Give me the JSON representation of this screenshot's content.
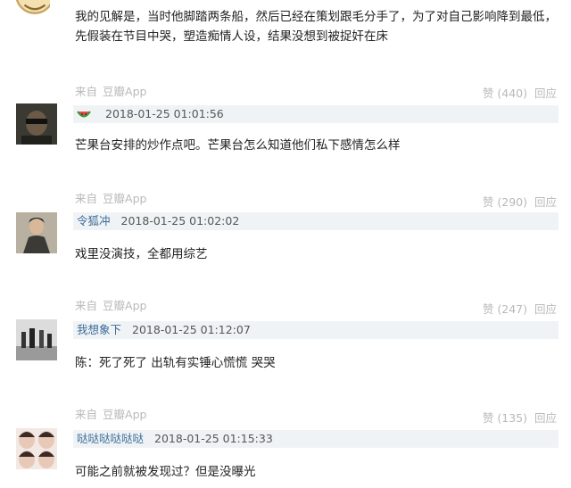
{
  "comments": [
    {
      "id": "c0",
      "text_lines": [
        "我的见解是，当时他脚踏两条船，然后已经在策划跟毛分手了，为了对自己影响降到最低，",
        "先假装在节目中哭，塑造痴情人设，结果没想到被捉奸在床"
      ],
      "source": {
        "prefix": "来自",
        "app": "豆瓣App"
      },
      "likes": "赞 (440)",
      "reply": "回应"
    },
    {
      "id": "c1",
      "user": "",
      "user_icon": "watermelon-icon",
      "time": "2018-01-25 01:01:56",
      "text": "芒果台安排的炒作点吧。芒果台怎么知道他们私下感情怎么样",
      "source": {
        "prefix": "来自",
        "app": "豆瓣App"
      },
      "likes": "赞 (290)",
      "reply": "回应"
    },
    {
      "id": "c2",
      "user": "令狐冲",
      "time": "2018-01-25 01:02:02",
      "text": "戏里没演技，全都用综艺",
      "source": {
        "prefix": "来自",
        "app": "豆瓣App"
      },
      "likes": "赞 (247)",
      "reply": "回应"
    },
    {
      "id": "c3",
      "user": "我想象下",
      "time": "2018-01-25 01:12:07",
      "text": "陈：死了死了 出轨有实锤心慌慌 哭哭",
      "source": {
        "prefix": "来自",
        "app": "豆瓣App"
      },
      "likes": "赞 (135)",
      "reply": "回应"
    },
    {
      "id": "c4",
      "user": "哒哒哒哒哒哒",
      "time": "2018-01-25 01:15:33",
      "text": "可能之前就被发现过？但是没曝光"
    }
  ],
  "colors": {
    "meta_bg": "#f0f3f5",
    "username": "#3b6c9a",
    "muted": "#b9b9b9",
    "text": "#222222"
  }
}
